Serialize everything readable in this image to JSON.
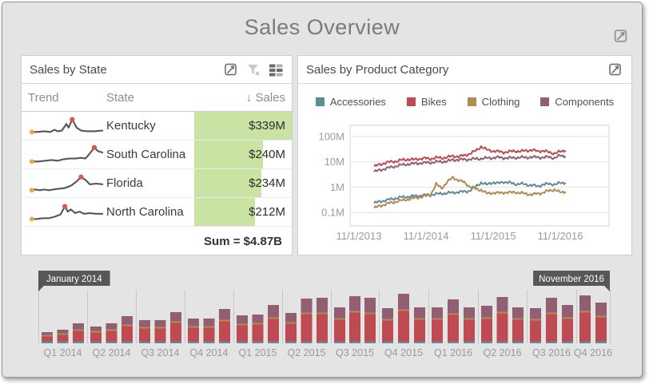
{
  "dashboard": {
    "title": "Sales Overview"
  },
  "palette": {
    "accessories": "#5f8b95",
    "bikes": "#c04a51",
    "clothing": "#b08c52",
    "components": "#925e72",
    "data_bar_green": "#c9e3a2",
    "spark_line": "#575757",
    "spark_start_dot": "#eaa744",
    "spark_peak_dot": "#e05452",
    "flag_bg": "#575757"
  },
  "sales_by_state": {
    "caption": "Sales by State",
    "icons": [
      "export",
      "clear-filter",
      "layout"
    ],
    "columns": {
      "trend": "Trend",
      "state": "State",
      "sales": "Sales",
      "sort_icon": "↓"
    },
    "rows": [
      {
        "state": "Kentucky",
        "sales": "$339M",
        "value_m": 339,
        "peak_index": 9,
        "spark": [
          [
            0,
            23
          ],
          [
            10,
            23
          ],
          [
            20,
            22
          ],
          [
            28,
            23
          ],
          [
            34,
            20
          ],
          [
            38,
            22
          ],
          [
            44,
            21
          ],
          [
            50,
            12
          ],
          [
            53,
            17
          ],
          [
            58,
            6
          ],
          [
            64,
            17
          ],
          [
            70,
            21
          ],
          [
            78,
            22
          ],
          [
            88,
            22
          ],
          [
            100,
            21
          ]
        ]
      },
      {
        "state": "South Carolina",
        "sales": "$240M",
        "value_m": 240,
        "peak_index": 11,
        "spark": [
          [
            0,
            24
          ],
          [
            12,
            24
          ],
          [
            22,
            23
          ],
          [
            30,
            22
          ],
          [
            38,
            23
          ],
          [
            46,
            21
          ],
          [
            54,
            20
          ],
          [
            62,
            20
          ],
          [
            70,
            19
          ],
          [
            76,
            20
          ],
          [
            82,
            13
          ],
          [
            88,
            5
          ],
          [
            93,
            10
          ],
          [
            100,
            12
          ]
        ]
      },
      {
        "state": "Florida",
        "sales": "$234M",
        "value_m": 234,
        "peak_index": 10,
        "spark": [
          [
            0,
            24
          ],
          [
            8,
            23
          ],
          [
            14,
            24
          ],
          [
            20,
            23
          ],
          [
            26,
            24
          ],
          [
            32,
            23
          ],
          [
            40,
            22
          ],
          [
            48,
            21
          ],
          [
            56,
            18
          ],
          [
            64,
            12
          ],
          [
            70,
            6
          ],
          [
            76,
            10
          ],
          [
            82,
            16
          ],
          [
            90,
            15
          ],
          [
            100,
            16
          ]
        ]
      },
      {
        "state": "North Carolina",
        "sales": "$212M",
        "value_m": 212,
        "peak_index": 6,
        "spark": [
          [
            0,
            24
          ],
          [
            10,
            24
          ],
          [
            18,
            23
          ],
          [
            26,
            23
          ],
          [
            34,
            21
          ],
          [
            42,
            18
          ],
          [
            48,
            7
          ],
          [
            52,
            14
          ],
          [
            56,
            11
          ],
          [
            62,
            16
          ],
          [
            68,
            14
          ],
          [
            74,
            17
          ],
          [
            82,
            16
          ],
          [
            90,
            17
          ],
          [
            100,
            17
          ]
        ]
      }
    ],
    "max_value_m": 339,
    "summary": "Sum = $4.87B"
  },
  "sales_by_category": {
    "caption": "Sales by Product Category"
  },
  "range_selector": {
    "flag_start": "January 2014",
    "flag_end": "November 2016"
  },
  "chart_data": [
    {
      "id": "sales-by-product-category",
      "type": "line",
      "y_scale": "log",
      "title": "Sales by Product Category",
      "x_tick_labels": [
        "11/1/2013",
        "11/1/2014",
        "11/1/2015",
        "11/1/2016"
      ],
      "y_tick_labels": [
        "100M",
        "10M",
        "1M",
        "0.1M"
      ],
      "ylim_millions": [
        0.03,
        280
      ],
      "x_months": "Jan 2014 - Nov 2016 (35 monthly points per series)",
      "legend_position": "top",
      "series": [
        {
          "name": "Accessories",
          "color_key": "accessories",
          "values_m": [
            0.23,
            0.27,
            0.3,
            0.33,
            0.37,
            0.4,
            0.42,
            0.44,
            0.46,
            0.48,
            0.5,
            0.53,
            0.56,
            0.58,
            0.61,
            0.64,
            0.66,
            0.72,
            1.05,
            1.5,
            1.25,
            1.55,
            1.4,
            1.62,
            1.5,
            1.32,
            1.36,
            1.25,
            1.2,
            1.07,
            1.28,
            1.34,
            1.3,
            1.42,
            1.5
          ]
        },
        {
          "name": "Bikes",
          "color_key": "bikes",
          "values_m": [
            6.5,
            7.8,
            9.2,
            10,
            10.6,
            11.8,
            12.6,
            12.2,
            13.2,
            13.8,
            13.2,
            14.6,
            14.2,
            15.2,
            16.8,
            16.2,
            17.8,
            21,
            27,
            40,
            30,
            27,
            25.5,
            24,
            25,
            27,
            25.5,
            28,
            29,
            26.5,
            27.5,
            24,
            21.5,
            25,
            28.5
          ]
        },
        {
          "name": "Clothing",
          "color_key": "clothing",
          "values_m": [
            0.15,
            0.18,
            0.21,
            0.24,
            0.27,
            0.3,
            0.33,
            0.36,
            0.4,
            0.44,
            0.48,
            1.3,
            0.92,
            1.6,
            2.4,
            1.85,
            1.55,
            1.05,
            0.85,
            0.78,
            0.56,
            0.6,
            0.58,
            0.62,
            0.6,
            0.64,
            0.58,
            0.55,
            0.5,
            0.56,
            0.6,
            0.72,
            0.8,
            0.62,
            0.66
          ]
        },
        {
          "name": "Components",
          "color_key": "components",
          "values_m": [
            4,
            4.7,
            5.4,
            6.1,
            6.9,
            7.6,
            8.1,
            8.4,
            8.9,
            9.1,
            9.4,
            9.9,
            10.1,
            10.6,
            11.9,
            12.1,
            12.4,
            12.6,
            13,
            13.4,
            14,
            14.4,
            14.9,
            14.4,
            14.1,
            14.5,
            15,
            14.8,
            15.4,
            15.1,
            14.9,
            15.4,
            14.2,
            17.4,
            16.6
          ]
        }
      ]
    },
    {
      "id": "range-selector",
      "type": "bar",
      "stacked": true,
      "categories": [
        "Q1 2014",
        "Q2 2014",
        "Q3 2014",
        "Q4 2014",
        "Q1 2015",
        "Q2 2015",
        "Q3 2015",
        "Q4 2015",
        "Q1 2016",
        "Q2 2016",
        "Q3 2016",
        "Q4 2016"
      ],
      "months_per_category": [
        3,
        3,
        3,
        3,
        3,
        3,
        3,
        3,
        3,
        3,
        3,
        2
      ],
      "segments_bottom_to_top": [
        "Accessories",
        "Bikes",
        "Clothing",
        "Components"
      ],
      "bar_total_heights_rel": [
        14,
        17,
        25,
        21,
        25,
        34,
        29,
        29,
        39,
        31,
        31,
        43,
        35,
        36,
        48,
        38,
        56,
        57,
        45,
        59,
        57,
        44,
        62,
        45,
        45,
        55,
        45,
        47,
        58,
        45,
        44,
        57,
        48,
        60,
        51
      ],
      "selection": {
        "start": "January 2014",
        "end": "November 2016"
      }
    }
  ]
}
